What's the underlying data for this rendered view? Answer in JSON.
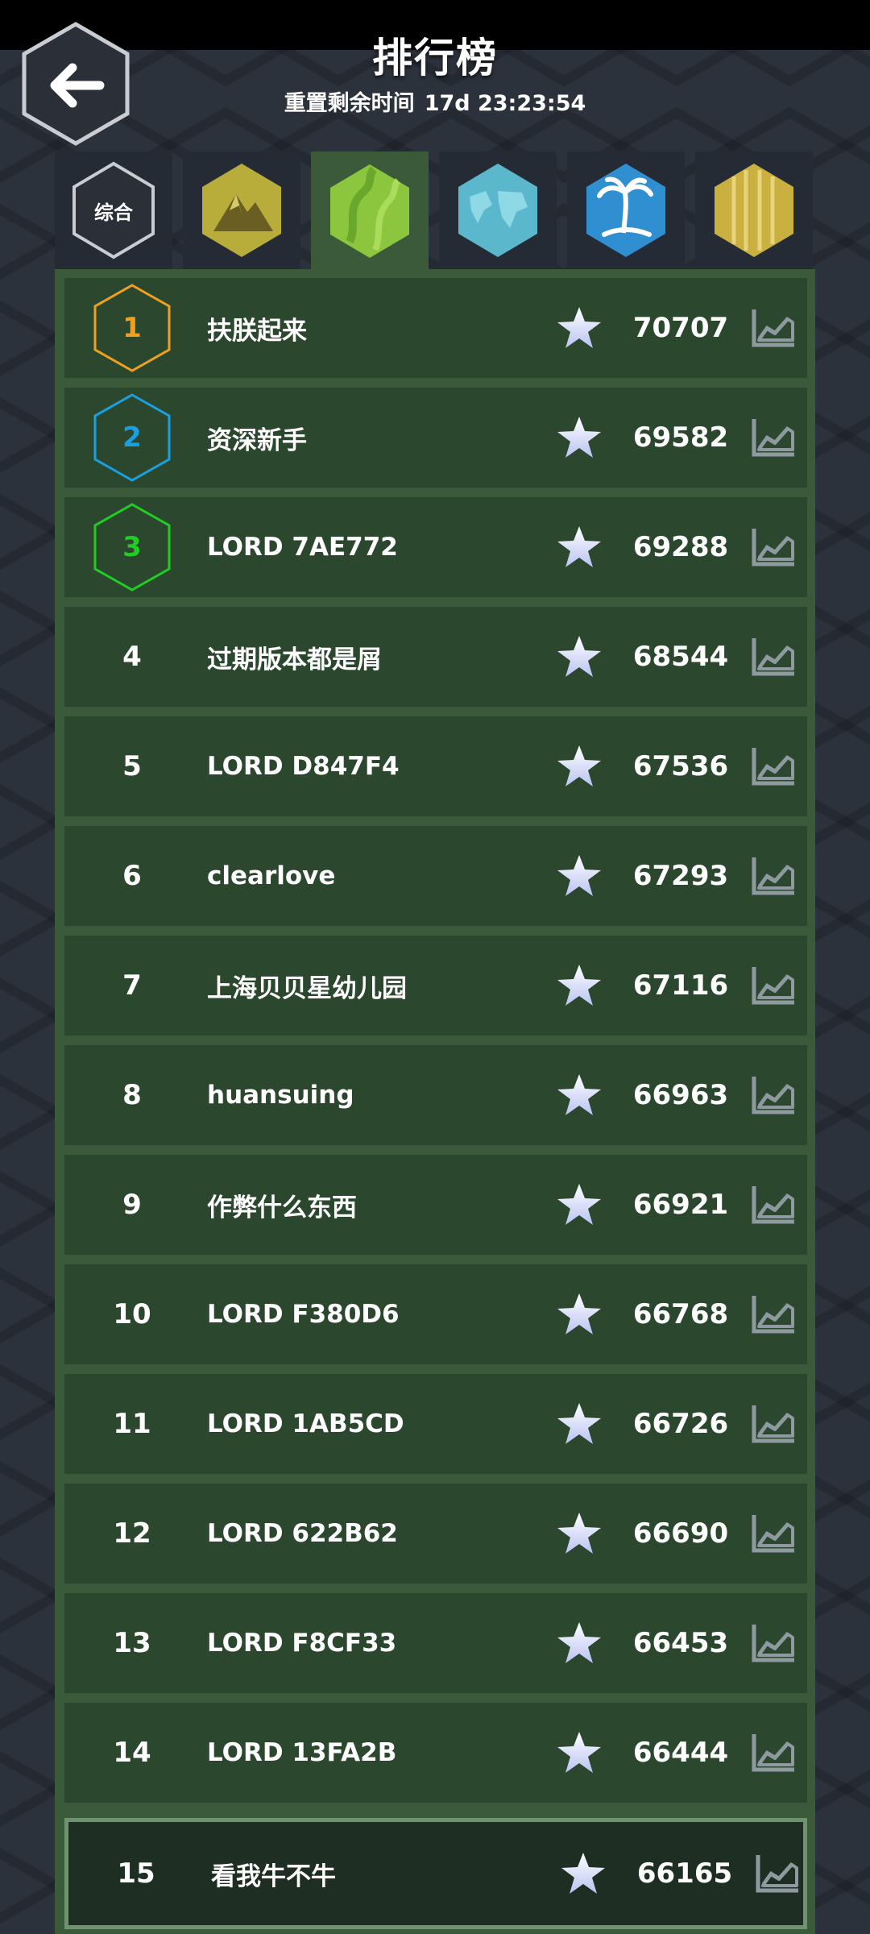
{
  "header": {
    "title": "排行榜",
    "reset_label": "重置剩余时间",
    "reset_time": "17d 23:23:54"
  },
  "tabs": [
    {
      "id": "overall",
      "label": "综合",
      "icon": "overall-hex-icon"
    },
    {
      "id": "mountain",
      "label": "",
      "icon": "mountain-hex-icon"
    },
    {
      "id": "grassland",
      "label": "",
      "icon": "grassland-hex-icon",
      "active": true
    },
    {
      "id": "world",
      "label": "",
      "icon": "world-map-hex-icon"
    },
    {
      "id": "island",
      "label": "",
      "icon": "palm-island-hex-icon"
    },
    {
      "id": "gold",
      "label": "",
      "icon": "gold-hex-icon"
    }
  ],
  "colors": {
    "rank1": "#f0a020",
    "rank2": "#1aa0e0",
    "rank3": "#22cc22",
    "row_bg": "#2b472e",
    "panel_bg": "#3a5a3a"
  },
  "leaderboard": [
    {
      "rank": "1",
      "name": "扶朕起来",
      "score": "70707"
    },
    {
      "rank": "2",
      "name": "资深新手",
      "score": "69582"
    },
    {
      "rank": "3",
      "name": "LORD 7AE772",
      "score": "69288"
    },
    {
      "rank": "4",
      "name": "过期版本都是屑",
      "score": "68544"
    },
    {
      "rank": "5",
      "name": "LORD D847F4",
      "score": "67536"
    },
    {
      "rank": "6",
      "name": "clearlove",
      "score": "67293"
    },
    {
      "rank": "7",
      "name": "上海贝贝星幼儿园",
      "score": "67116"
    },
    {
      "rank": "8",
      "name": "huansuing",
      "score": "66963"
    },
    {
      "rank": "9",
      "name": "作弊什么东西",
      "score": "66921"
    },
    {
      "rank": "10",
      "name": "LORD F380D6",
      "score": "66768"
    },
    {
      "rank": "11",
      "name": "LORD 1AB5CD",
      "score": "66726"
    },
    {
      "rank": "12",
      "name": "LORD 622B62",
      "score": "66690"
    },
    {
      "rank": "13",
      "name": "LORD F8CF33",
      "score": "66453"
    },
    {
      "rank": "14",
      "name": "LORD 13FA2B",
      "score": "66444"
    }
  ],
  "self_entry": {
    "rank": "15",
    "name": "看我牛不牛",
    "score": "66165"
  }
}
